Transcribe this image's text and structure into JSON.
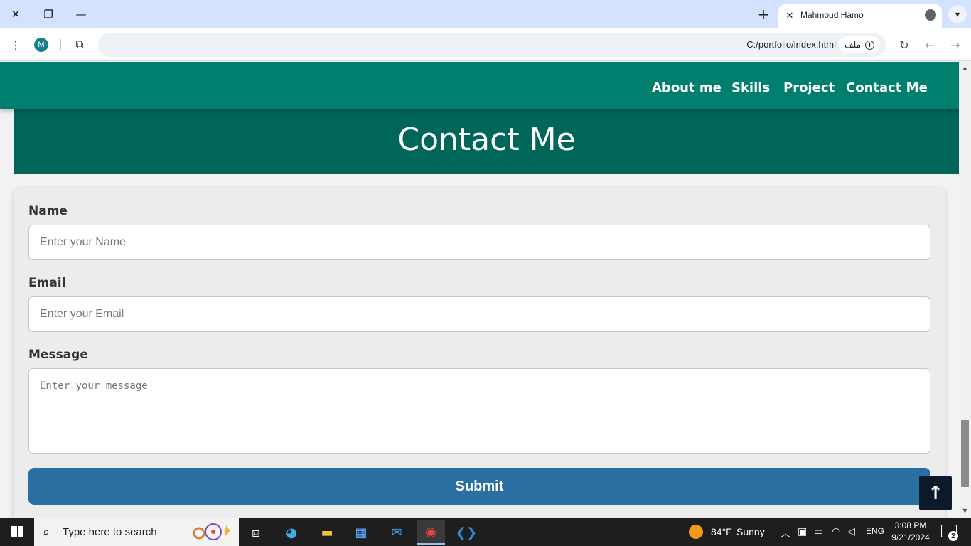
{
  "browser": {
    "tab_title": "Mahmoud Hamo",
    "url": "C:/portfolio/index.html",
    "site_chip_label": "ملف",
    "profile_initial": "M"
  },
  "nav": {
    "items": [
      "About me",
      "Skills",
      "Project",
      "Contact Me"
    ]
  },
  "section": {
    "title": "Contact Me"
  },
  "form": {
    "name_label": "Name",
    "name_placeholder": "Enter your Name",
    "email_label": "Email",
    "email_placeholder": "Enter your Email",
    "message_label": "Message",
    "message_placeholder": "Enter your message",
    "submit_label": "Submit"
  },
  "back_to_top_icon": "arrow-up-icon",
  "taskbar": {
    "search_placeholder": "Type here to search",
    "weather_temp": "84°F",
    "weather_desc": "Sunny",
    "language": "ENG",
    "time": "3:08 PM",
    "date": "9/21/2024",
    "notification_count": "2"
  },
  "colors": {
    "nav_bg": "#007e6e",
    "banner_bg": "#00665a",
    "submit_bg": "#2a6fa1",
    "tab_strip_bg": "#d3e3fd"
  }
}
